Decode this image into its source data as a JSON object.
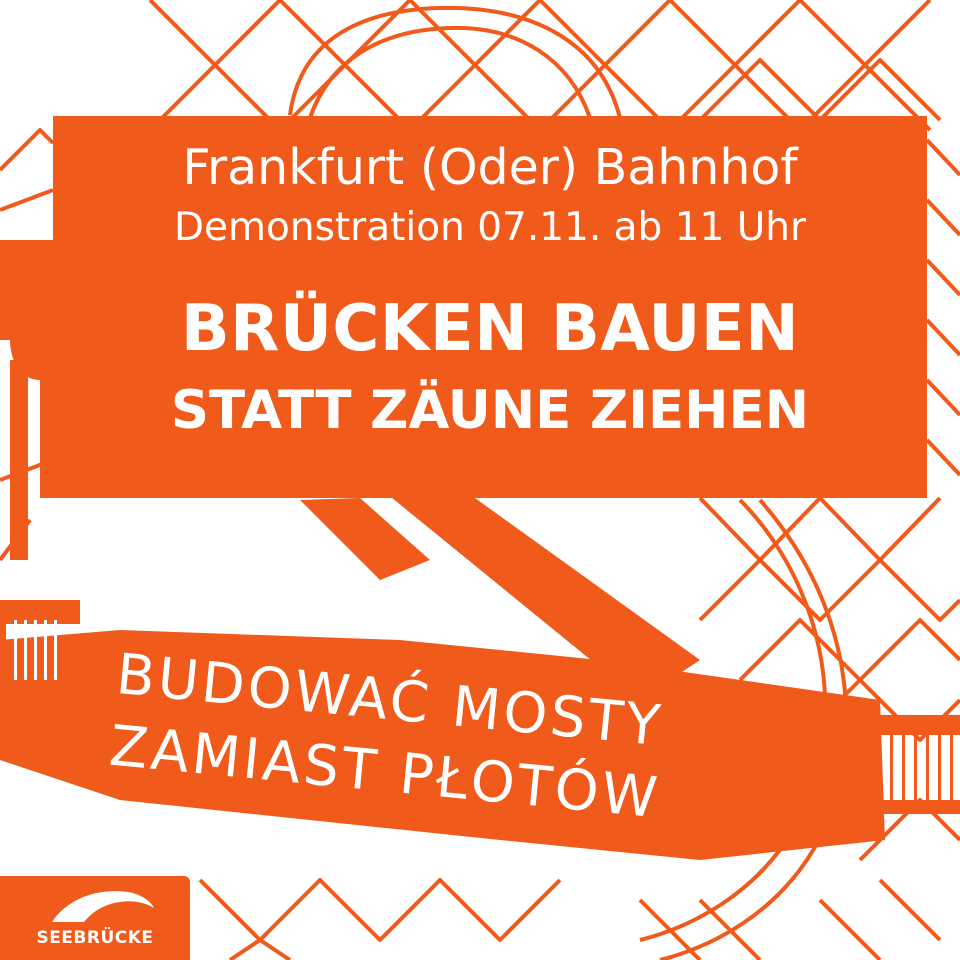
{
  "colors": {
    "accent": "#f05a1a",
    "background": "#ffffff",
    "text": "#ffffff"
  },
  "headline": {
    "location": "Frankfurt (Oder) Bahnhof",
    "event": "Demonstration 07.11. ab 11 Uhr",
    "slogan_line1": "BRÜCKEN BAUEN",
    "slogan_line2": "STATT ZÄUNE ZIEHEN"
  },
  "polish": {
    "line1": "BUDOWAĆ MOSTY",
    "line2": "ZAMIAST PŁOTÓW"
  },
  "logo": {
    "name": "SEEBRÜCKE",
    "icon": "wave-logo-icon"
  },
  "illustration": {
    "elements": [
      "chain-link-fence",
      "bridge"
    ]
  }
}
